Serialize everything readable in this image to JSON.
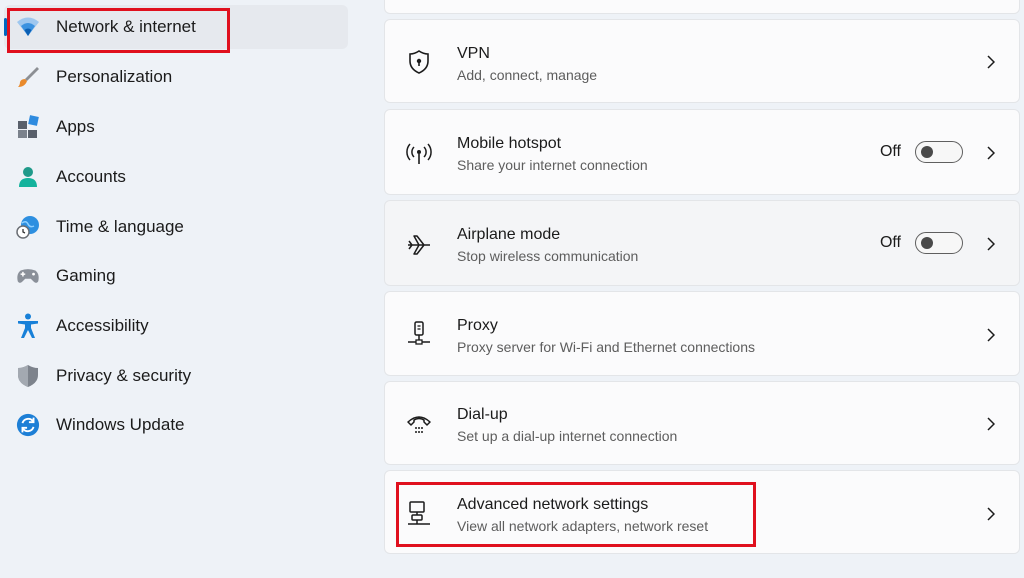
{
  "sidebar": {
    "items": [
      {
        "label": "Network & internet",
        "icon": "wifi-icon",
        "selected": true
      },
      {
        "label": "Personalization",
        "icon": "paintbrush-icon"
      },
      {
        "label": "Apps",
        "icon": "apps-icon"
      },
      {
        "label": "Accounts",
        "icon": "person-icon"
      },
      {
        "label": "Time & language",
        "icon": "globe-clock-icon"
      },
      {
        "label": "Gaming",
        "icon": "gamepad-icon"
      },
      {
        "label": "Accessibility",
        "icon": "accessibility-icon"
      },
      {
        "label": "Privacy & security",
        "icon": "shield-icon"
      },
      {
        "label": "Windows Update",
        "icon": "update-icon"
      }
    ]
  },
  "settings": {
    "vpn": {
      "title": "VPN",
      "subtitle": "Add, connect, manage",
      "icon": "vpn-shield-icon"
    },
    "hotspot": {
      "title": "Mobile hotspot",
      "subtitle": "Share your internet connection",
      "toggle_label": "Off",
      "icon": "hotspot-icon"
    },
    "airplane": {
      "title": "Airplane mode",
      "subtitle": "Stop wireless communication",
      "toggle_label": "Off",
      "icon": "airplane-icon"
    },
    "proxy": {
      "title": "Proxy",
      "subtitle": "Proxy server for Wi-Fi and Ethernet connections",
      "icon": "proxy-icon"
    },
    "dialup": {
      "title": "Dial-up",
      "subtitle": "Set up a dial-up internet connection",
      "icon": "dialup-icon"
    },
    "advanced": {
      "title": "Advanced network settings",
      "subtitle": "View all network adapters, network reset",
      "icon": "network-pc-icon"
    }
  },
  "colors": {
    "accent": "#0067c0",
    "highlight": "#e0101e"
  }
}
